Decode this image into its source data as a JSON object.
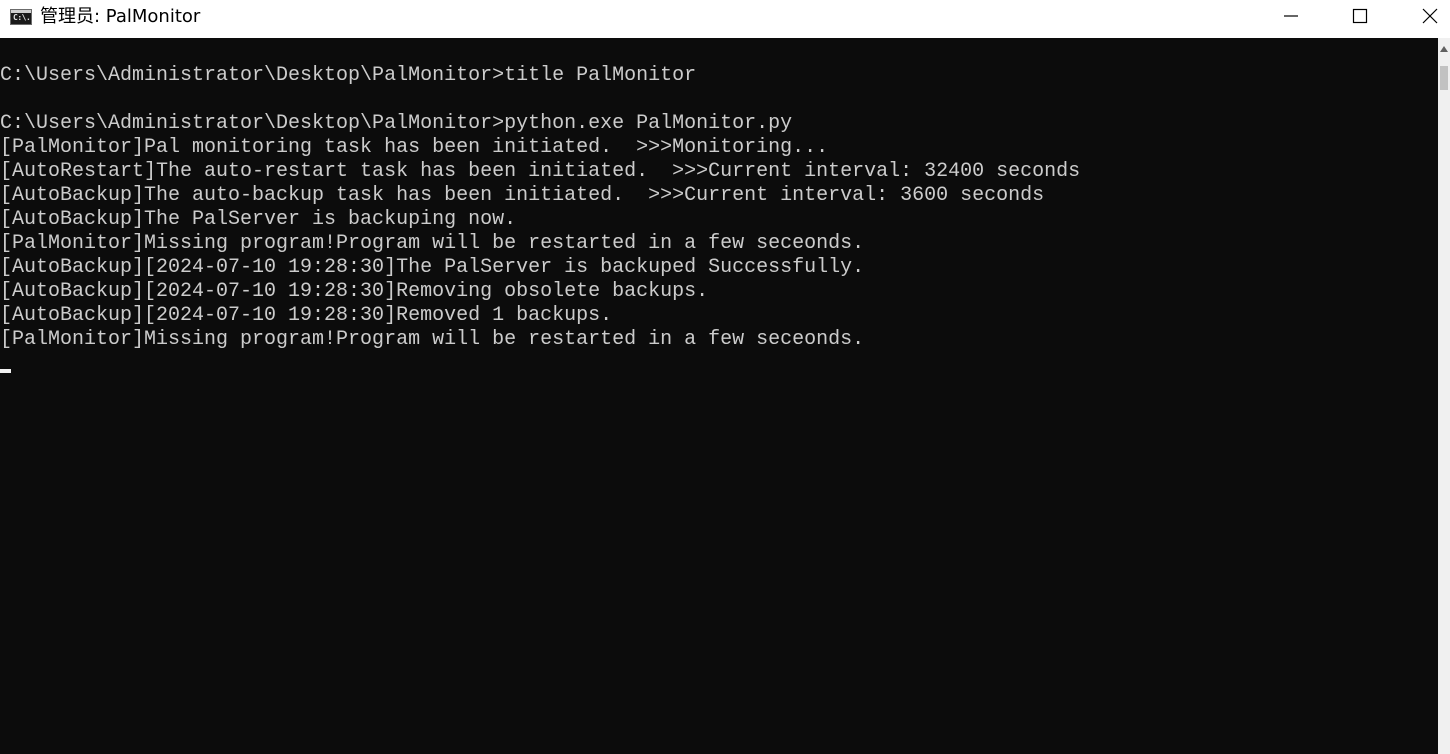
{
  "window": {
    "title": "管理员:  PalMonitor",
    "icon_label": "C:\\.",
    "controls": {
      "minimize_icon": "minimize-icon",
      "maximize_icon": "maximize-icon",
      "close_icon": "close-icon"
    }
  },
  "console": {
    "foreground_color": "#cccccc",
    "background_color": "#0c0c0c",
    "lines": [
      "",
      "C:\\Users\\Administrator\\Desktop\\PalMonitor>title PalMonitor",
      "",
      "C:\\Users\\Administrator\\Desktop\\PalMonitor>python.exe PalMonitor.py",
      "[PalMonitor]Pal monitoring task has been initiated.  >>>Monitoring...",
      "[AutoRestart]The auto-restart task has been initiated.  >>>Current interval: 32400 seconds",
      "[AutoBackup]The auto-backup task has been initiated.  >>>Current interval: 3600 seconds",
      "[AutoBackup]The PalServer is backuping now.",
      "[PalMonitor]Missing program!Program will be restarted in a few seceonds.",
      "[AutoBackup][2024-07-10 19:28:30]The PalServer is backuped Successfully.",
      "[AutoBackup][2024-07-10 19:28:30]Removing obsolete backups.",
      "[AutoBackup][2024-07-10 19:28:30]Removed 1 backups.",
      "[PalMonitor]Missing program!Program will be restarted in a few seceonds."
    ]
  },
  "scrollbar": {
    "up_icon": "scroll-up-arrow-icon"
  }
}
